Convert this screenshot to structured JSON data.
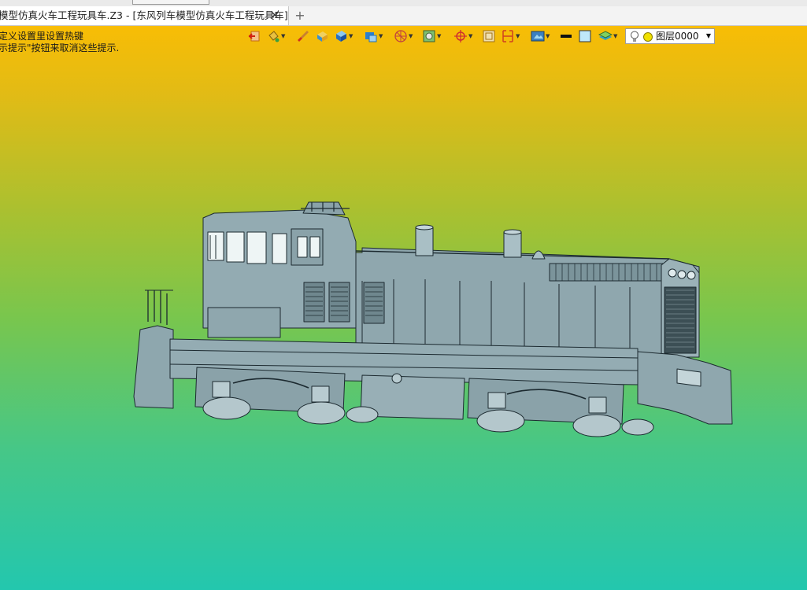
{
  "tab": {
    "title": "模型仿真火车工程玩具车.Z3 - [东风列车模型仿真火车工程玩具车]",
    "close_glyph": "✕",
    "new_tab_glyph": "+"
  },
  "hints": {
    "line1": "定义设置里设置热键",
    "line2": "示提示\"按钮来取消这些提示."
  },
  "toolbar": {
    "layer_name": "图层0000",
    "icons": [
      "exit-icon",
      "paint-bucket-icon",
      "brush-icon",
      "face-color-icon",
      "cube-shade-icon",
      "display-mode-icon",
      "wireframe-sphere-icon",
      "view-box-icon",
      "axis-target-icon",
      "frame-icon",
      "bracket-icon",
      "render-view-icon",
      "line-color-swatch",
      "fill-color-swatch",
      "layer-stack-icon"
    ]
  },
  "colors": {
    "bg_top": "#f8bd05",
    "bg_bottom": "#23c7ae",
    "model_body": "#8fa7ae"
  }
}
